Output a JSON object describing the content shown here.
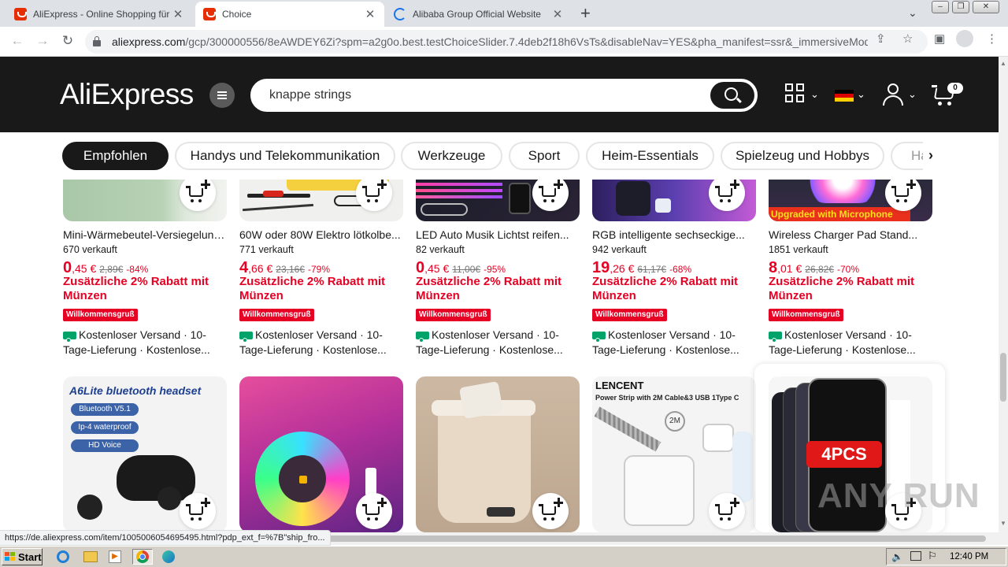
{
  "browser": {
    "tabs": [
      {
        "title": "AliExpress - Online Shopping für Elek",
        "active": false
      },
      {
        "title": "Choice",
        "active": true
      },
      {
        "title": "Alibaba Group Official Website",
        "active": false,
        "loading": true
      }
    ],
    "url_host": "aliexpress.com",
    "url_path": "/gcp/300000556/8eAWDEY6Zi?spm=a2g0o.best.testChoiceSlider.7.4deb2f18h6VsTs&disableNav=YES&pha_manifest=ssr&_immersiveMode..."
  },
  "header": {
    "logo": "AliExpress",
    "search_value": "knappe strings",
    "cart_count": "0"
  },
  "categories": [
    "Empfohlen",
    "Handys und Telekommunikation",
    "Werkzeuge",
    "Sport",
    "Heim-Essentials",
    "Spielzeug und Hobbys",
    "Ha"
  ],
  "products_row1": [
    {
      "title": "Mini-Wärmebeutel-Versiegelung...",
      "sold": "670 verkauft",
      "price_int": "0",
      "price_dec": ",45 €",
      "old": "2,89€",
      "disc": "-84%"
    },
    {
      "title": "60W oder 80W Elektro lötkolbe...",
      "sold": "771 verkauft",
      "price_int": "4",
      "price_dec": ",66 €",
      "old": "23,16€",
      "disc": "-79%"
    },
    {
      "title": "LED Auto Musik Lichtst reifen...",
      "sold": "82 verkauft",
      "price_int": "0",
      "price_dec": ",45 €",
      "old": "11,00€",
      "disc": "-95%"
    },
    {
      "title": "RGB intelligente sechseckige...",
      "sold": "942 verkauft",
      "price_int": "19",
      "price_dec": ",26 €",
      "old": "61,17€",
      "disc": "-68%"
    },
    {
      "title": "Wireless Charger Pad Stand...",
      "sold": "1851 verkauft",
      "price_int": "8",
      "price_dec": ",01 €",
      "old": "26,82€",
      "disc": "-70%"
    }
  ],
  "promo": {
    "coins": "Zusätzliche 2% Rabatt mit Münzen",
    "welcome": "Willkommensgruß",
    "shipping": "Kostenloser Versand · 10-Tage-Lieferung · Kostenlose..."
  },
  "product_image_texts": {
    "upgraded_mic": "Upgraded with Microphone",
    "a6lite_title": "A6Lite bluetooth headset",
    "a6lite_features": [
      "Bluetooth V5.1",
      "Ip-4 waterproof",
      "HD Voice"
    ],
    "lencent_brand": "LENCENT",
    "lencent_sub": "Power Strip with 2M Cable&3 USB 1Type C",
    "lencent_cable": "2M",
    "fourpcs": "4PCS"
  },
  "status_url": "https://de.aliexpress.com/item/1005006054695495.html?pdp_ext_f=%7B\"ship_fro...",
  "taskbar": {
    "start": "Start",
    "clock": "12:40 PM"
  },
  "watermark": "ANY RUN",
  "colors": {
    "accent": "#e60023",
    "header_bg": "#191919",
    "ship_green": "#00a368"
  }
}
